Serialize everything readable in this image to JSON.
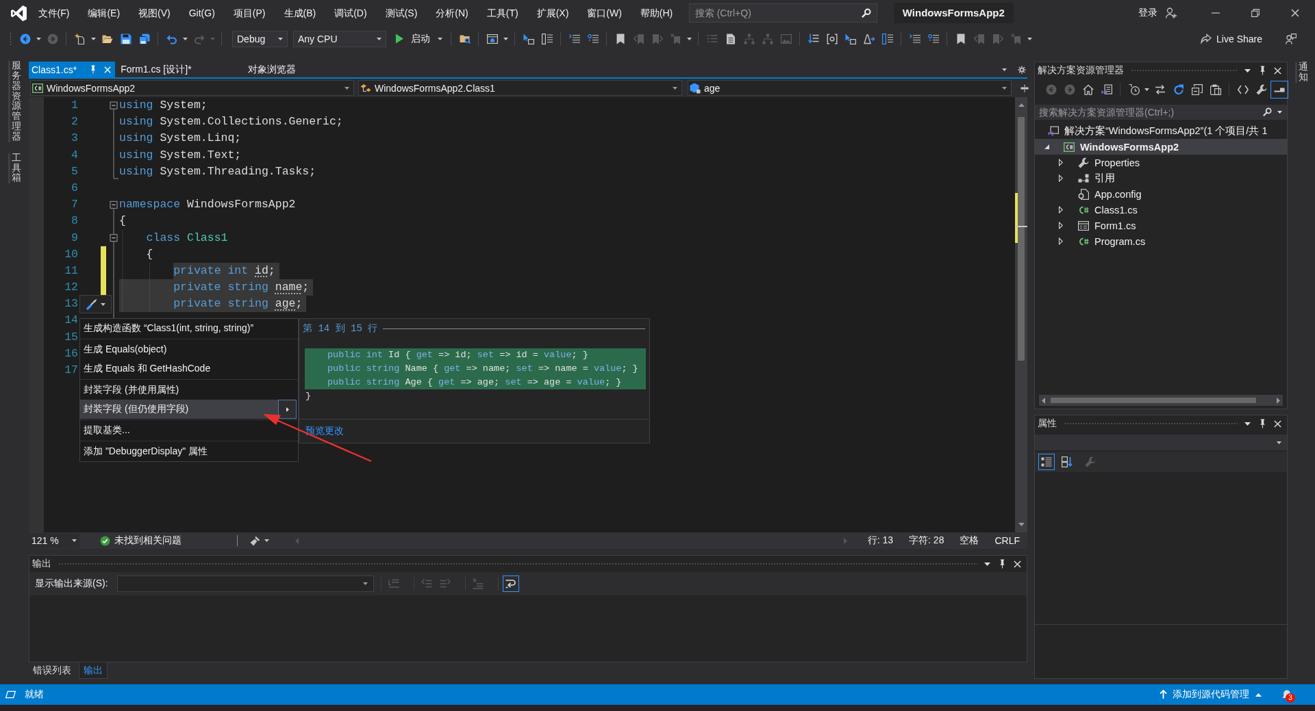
{
  "menu_bar": {
    "items": [
      "文件(F)",
      "编辑(E)",
      "视图(V)",
      "Git(G)",
      "项目(P)",
      "生成(B)",
      "调试(D)",
      "测试(S)",
      "分析(N)",
      "工具(T)",
      "扩展(X)",
      "窗口(W)",
      "帮助(H)"
    ],
    "search": {
      "placeholder": "搜索 (Ctrl+Q)"
    },
    "title": "WindowsFormsApp2",
    "sign_in": "登录"
  },
  "toolbar": {
    "items": [
      {
        "kind": "icon",
        "disabled": false
      },
      {
        "kind": "caret",
        "disabled": false
      },
      {
        "kind": "icon",
        "disabled": true
      },
      {
        "kind": "separator"
      },
      {
        "kind": "icon",
        "disabled": false
      },
      {
        "kind": "caret",
        "disabled": false
      },
      {
        "kind": "icon",
        "disabled": false
      },
      {
        "kind": "icon",
        "disabled": false
      },
      {
        "kind": "icon",
        "disabled": false
      },
      {
        "kind": "separator"
      },
      {
        "kind": "icon",
        "disabled": false
      },
      {
        "kind": "caret",
        "disabled": false
      },
      {
        "kind": "icon",
        "disabled": true
      },
      {
        "kind": "caret",
        "disabled": true
      },
      {
        "kind": "separator"
      },
      {
        "kind": "combo",
        "value": "Debug"
      },
      {
        "kind": "combo",
        "value": "Any CPU"
      },
      {
        "kind": "run",
        "label": "启动"
      },
      {
        "kind": "separator"
      },
      {
        "kind": "icon",
        "disabled": false
      },
      {
        "kind": "separator"
      },
      {
        "kind": "icon",
        "disabled": false
      },
      {
        "kind": "caret",
        "disabled": false
      },
      {
        "kind": "separator"
      },
      {
        "kind": "icon",
        "disabled": false
      },
      {
        "kind": "icon",
        "disabled": false
      },
      {
        "kind": "separator"
      },
      {
        "kind": "icon",
        "disabled": false
      },
      {
        "kind": "icon",
        "disabled": false
      },
      {
        "kind": "separator"
      },
      {
        "kind": "icon",
        "disabled": false
      },
      {
        "kind": "icon",
        "disabled": true
      },
      {
        "kind": "icon",
        "disabled": true
      },
      {
        "kind": "icon",
        "disabled": true
      },
      {
        "kind": "caret",
        "disabled": false
      },
      {
        "kind": "separator"
      },
      {
        "kind": "icon",
        "disabled": true
      },
      {
        "kind": "icon",
        "disabled": false
      },
      {
        "kind": "icon",
        "disabled": true
      },
      {
        "kind": "icon",
        "disabled": true
      },
      {
        "kind": "icon",
        "disabled": true
      },
      {
        "kind": "separator"
      },
      {
        "kind": "icon",
        "disabled": false
      },
      {
        "kind": "icon",
        "disabled": false
      },
      {
        "kind": "icon",
        "disabled": false
      },
      {
        "kind": "icon",
        "disabled": false
      },
      {
        "kind": "icon",
        "disabled": false
      },
      {
        "kind": "separator"
      },
      {
        "kind": "icon",
        "disabled": false
      },
      {
        "kind": "icon",
        "disabled": false
      },
      {
        "kind": "separator"
      },
      {
        "kind": "icon",
        "disabled": false
      },
      {
        "kind": "icon",
        "disabled": true
      },
      {
        "kind": "icon",
        "disabled": true
      },
      {
        "kind": "icon",
        "disabled": true
      },
      {
        "kind": "caret",
        "disabled": false
      }
    ],
    "live_share": "Live Share"
  },
  "left_side_tabs": [
    "服务器资源管理器",
    "工具箱"
  ],
  "right_side_tabs": [
    "通知"
  ],
  "document_tabs": [
    {
      "label": "Class1.cs*",
      "selected": true
    },
    {
      "label": "Form1.cs [设计]*",
      "selected": false
    },
    {
      "label": "对象浏览器",
      "selected": false
    }
  ],
  "navigation_bar": [
    {
      "kind": "project",
      "value": "WindowsFormsApp2"
    },
    {
      "kind": "class",
      "value": "WindowsFormsApp2.Class1"
    },
    {
      "kind": "member",
      "value": "age"
    }
  ],
  "editor": {
    "lines": [
      {
        "number": "1",
        "collapsible": true,
        "fold_end": false,
        "changed": false,
        "selected": false,
        "tokens": [
          {
            "text": "using",
            "kind": "keyword"
          },
          {
            "text": " System;",
            "kind": "plain"
          }
        ]
      },
      {
        "number": "2",
        "collapsible": false,
        "fold_end": false,
        "changed": false,
        "selected": false,
        "tokens": [
          {
            "text": "using",
            "kind": "keyword"
          },
          {
            "text": " System.Collections.Generic;",
            "kind": "plain"
          }
        ]
      },
      {
        "number": "3",
        "collapsible": false,
        "fold_end": false,
        "changed": false,
        "selected": false,
        "tokens": [
          {
            "text": "using",
            "kind": "keyword"
          },
          {
            "text": " System.Linq;",
            "kind": "plain"
          }
        ]
      },
      {
        "number": "4",
        "collapsible": false,
        "fold_end": false,
        "changed": false,
        "selected": false,
        "tokens": [
          {
            "text": "using",
            "kind": "keyword"
          },
          {
            "text": " System.Text;",
            "kind": "plain"
          }
        ]
      },
      {
        "number": "5",
        "collapsible": false,
        "fold_end": true,
        "changed": false,
        "selected": false,
        "tokens": [
          {
            "text": "using",
            "kind": "keyword"
          },
          {
            "text": " System.Threading.Tasks;",
            "kind": "plain"
          }
        ]
      },
      {
        "number": "6",
        "collapsible": false,
        "fold_end": false,
        "changed": false,
        "selected": false
      },
      {
        "number": "7",
        "collapsible": true,
        "fold_end": false,
        "changed": false,
        "selected": false,
        "tokens": [
          {
            "text": "namespace",
            "kind": "keyword"
          },
          {
            "text": " WindowsFormsApp2",
            "kind": "plain"
          }
        ]
      },
      {
        "number": "8",
        "collapsible": false,
        "fold_end": false,
        "changed": false,
        "selected": false,
        "tokens": [
          {
            "text": "{",
            "kind": "plain"
          }
        ]
      },
      {
        "number": "9",
        "collapsible": true,
        "fold_end": false,
        "changed": false,
        "selected": false,
        "tokens": [
          {
            "text": "    class",
            "kind": "keyword"
          },
          {
            "text": " Class1",
            "kind": "type"
          }
        ]
      },
      {
        "number": "10",
        "collapsible": false,
        "fold_end": false,
        "changed": true,
        "selected": false,
        "tokens": [
          {
            "text": "    {",
            "kind": "plain"
          }
        ]
      },
      {
        "number": "11",
        "collapsible": false,
        "fold_end": false,
        "changed": true,
        "selected": true,
        "tokens": [
          {
            "text": "        private int ",
            "kind": "keyword"
          },
          {
            "text": "id",
            "kind": "suggested"
          },
          {
            "text": ";",
            "kind": "plain"
          }
        ]
      },
      {
        "number": "12",
        "collapsible": false,
        "fold_end": false,
        "changed": true,
        "selected": true,
        "tokens": [
          {
            "text": "        private string ",
            "kind": "keyword"
          },
          {
            "text": "name",
            "kind": "suggested"
          },
          {
            "text": ";",
            "kind": "plain"
          }
        ]
      },
      {
        "number": "13",
        "collapsible": false,
        "fold_end": false,
        "changed": false,
        "selected": true,
        "tokens": [
          {
            "text": "        private string ",
            "kind": "keyword"
          },
          {
            "text": "age",
            "kind": "suggested"
          },
          {
            "text": ";",
            "kind": "plain"
          }
        ]
      },
      {
        "number": "14",
        "collapsible": false,
        "fold_end": false,
        "changed": false
      },
      {
        "number": "15",
        "collapsible": false,
        "fold_end": false,
        "changed": false
      },
      {
        "number": "16",
        "collapsible": false,
        "fold_end": false,
        "changed": false
      },
      {
        "number": "17",
        "collapsible": false,
        "fold_end": false,
        "changed": false
      }
    ],
    "quick_actions": {
      "groups": [
        {
          "items": [
            {
              "label": "生成构造函数 “Class1(int, string, string)”",
              "selected": false,
              "submenu": false
            }
          ]
        },
        {
          "items": [
            {
              "label": "生成 Equals(object)",
              "selected": false,
              "submenu": false
            },
            {
              "label": "生成 Equals 和 GetHashCode",
              "selected": false,
              "submenu": false
            }
          ]
        },
        {
          "items": [
            {
              "label": "封装字段 (并使用属性)",
              "selected": false,
              "submenu": false
            },
            {
              "label": "封装字段 (但仍使用字段)",
              "selected": true,
              "submenu": true
            }
          ]
        },
        {
          "items": [
            {
              "label": "提取基类...",
              "selected": false,
              "submenu": false
            }
          ]
        },
        {
          "items": [
            {
              "label": "添加 \"DebuggerDisplay\" 属性",
              "selected": false,
              "submenu": false
            }
          ]
        }
      ]
    },
    "preview": {
      "header": "第 14 到 15 行",
      "added_lines": [
        {
          "tokens": [
            {
              "text": "public int",
              "kind": "keyword"
            },
            {
              "text": " Id { ",
              "kind": "plain"
            },
            {
              "text": "get",
              "kind": "keyword"
            },
            {
              "text": " => id; ",
              "kind": "plain"
            },
            {
              "text": "set",
              "kind": "keyword"
            },
            {
              "text": " => id = ",
              "kind": "plain"
            },
            {
              "text": "value",
              "kind": "keyword"
            },
            {
              "text": "; }",
              "kind": "plain"
            }
          ]
        },
        {
          "tokens": [
            {
              "text": "public string",
              "kind": "keyword"
            },
            {
              "text": " Name { ",
              "kind": "plain"
            },
            {
              "text": "get",
              "kind": "keyword"
            },
            {
              "text": " => name; ",
              "kind": "plain"
            },
            {
              "text": "set",
              "kind": "keyword"
            },
            {
              "text": " => name = ",
              "kind": "plain"
            },
            {
              "text": "value",
              "kind": "keyword"
            },
            {
              "text": "; }",
              "kind": "plain"
            }
          ]
        },
        {
          "tokens": [
            {
              "text": "public string",
              "kind": "keyword"
            },
            {
              "text": " Age { ",
              "kind": "plain"
            },
            {
              "text": "get",
              "kind": "keyword"
            },
            {
              "text": " => age; ",
              "kind": "plain"
            },
            {
              "text": "set",
              "kind": "keyword"
            },
            {
              "text": " => age = ",
              "kind": "plain"
            },
            {
              "text": "value",
              "kind": "keyword"
            },
            {
              "text": "; }",
              "kind": "plain"
            }
          ]
        }
      ],
      "context_lines": [
        "}"
      ],
      "link": "预览更改"
    }
  },
  "editor_status": {
    "zoom": "121 %",
    "issues": "未找到相关问题",
    "line": "行: 13",
    "column": "字符: 28",
    "whitespace": "空格",
    "line_ending": "CRLF"
  },
  "output_panel": {
    "title": "输出",
    "source_label": "显示输出来源(S):",
    "tools": [
      {
        "disabled": true,
        "selected": false
      },
      {
        "disabled": true,
        "selected": false
      },
      {
        "disabled": true,
        "selected": false
      },
      {
        "disabled": true,
        "selected": false
      },
      {
        "disabled": false,
        "selected": true
      }
    ]
  },
  "bottom_tabs": [
    {
      "label": "错误列表",
      "selected": false
    },
    {
      "label": "输出",
      "selected": true
    }
  ],
  "solution_explorer": {
    "title": "解决方案资源管理器",
    "tools": [
      {
        "kind": "icon",
        "disabled": true,
        "selected": false
      },
      {
        "kind": "icon",
        "disabled": true,
        "selected": false
      },
      {
        "kind": "icon",
        "disabled": false,
        "selected": false
      },
      {
        "kind": "icon",
        "disabled": false,
        "selected": false
      },
      {
        "kind": "separator"
      },
      {
        "kind": "icon",
        "disabled": false,
        "selected": false
      },
      {
        "kind": "caret",
        "disabled": false
      },
      {
        "kind": "icon",
        "disabled": false,
        "selected": false
      },
      {
        "kind": "icon",
        "disabled": false,
        "selected": false
      },
      {
        "kind": "icon",
        "disabled": false,
        "selected": false
      },
      {
        "kind": "icon",
        "disabled": false,
        "selected": false
      },
      {
        "kind": "separator"
      },
      {
        "kind": "icon",
        "disabled": false,
        "selected": false
      },
      {
        "kind": "icon",
        "disabled": false,
        "selected": false
      },
      {
        "kind": "icon",
        "disabled": false,
        "selected": true
      }
    ],
    "search": {
      "placeholder": "搜索解决方案资源管理器(Ctrl+;)"
    },
    "tree": [
      {
        "label": "解决方案“WindowsFormsApp2”(1 个项目/共 1",
        "kind": "solution",
        "selected": false,
        "children": [
          {
            "label": "WindowsFormsApp2",
            "kind": "project",
            "selected": true,
            "expanded": true,
            "children": [
              {
                "label": "Properties",
                "kind": "properties",
                "selected": false,
                "expanded": false,
                "expandable": true
              },
              {
                "label": "引用",
                "kind": "references",
                "selected": false,
                "expanded": false,
                "expandable": true
              },
              {
                "label": "App.config",
                "kind": "config",
                "selected": false,
                "expanded": false,
                "expandable": false
              },
              {
                "label": "Class1.cs",
                "kind": "csharp",
                "selected": false,
                "expanded": false,
                "expandable": true
              },
              {
                "label": "Form1.cs",
                "kind": "form",
                "selected": false,
                "expanded": false,
                "expandable": true
              },
              {
                "label": "Program.cs",
                "kind": "csharp",
                "selected": false,
                "expanded": false,
                "expandable": true
              }
            ]
          }
        ]
      }
    ]
  },
  "properties_panel": {
    "title": "属性",
    "tools": [
      {
        "disabled": false,
        "selected": true
      },
      {
        "disabled": false,
        "selected": false
      },
      {
        "disabled": true,
        "selected": false
      }
    ]
  },
  "status_bar": {
    "message": "就绪",
    "source_control": "添加到源代码管理",
    "notifications": "3"
  }
}
